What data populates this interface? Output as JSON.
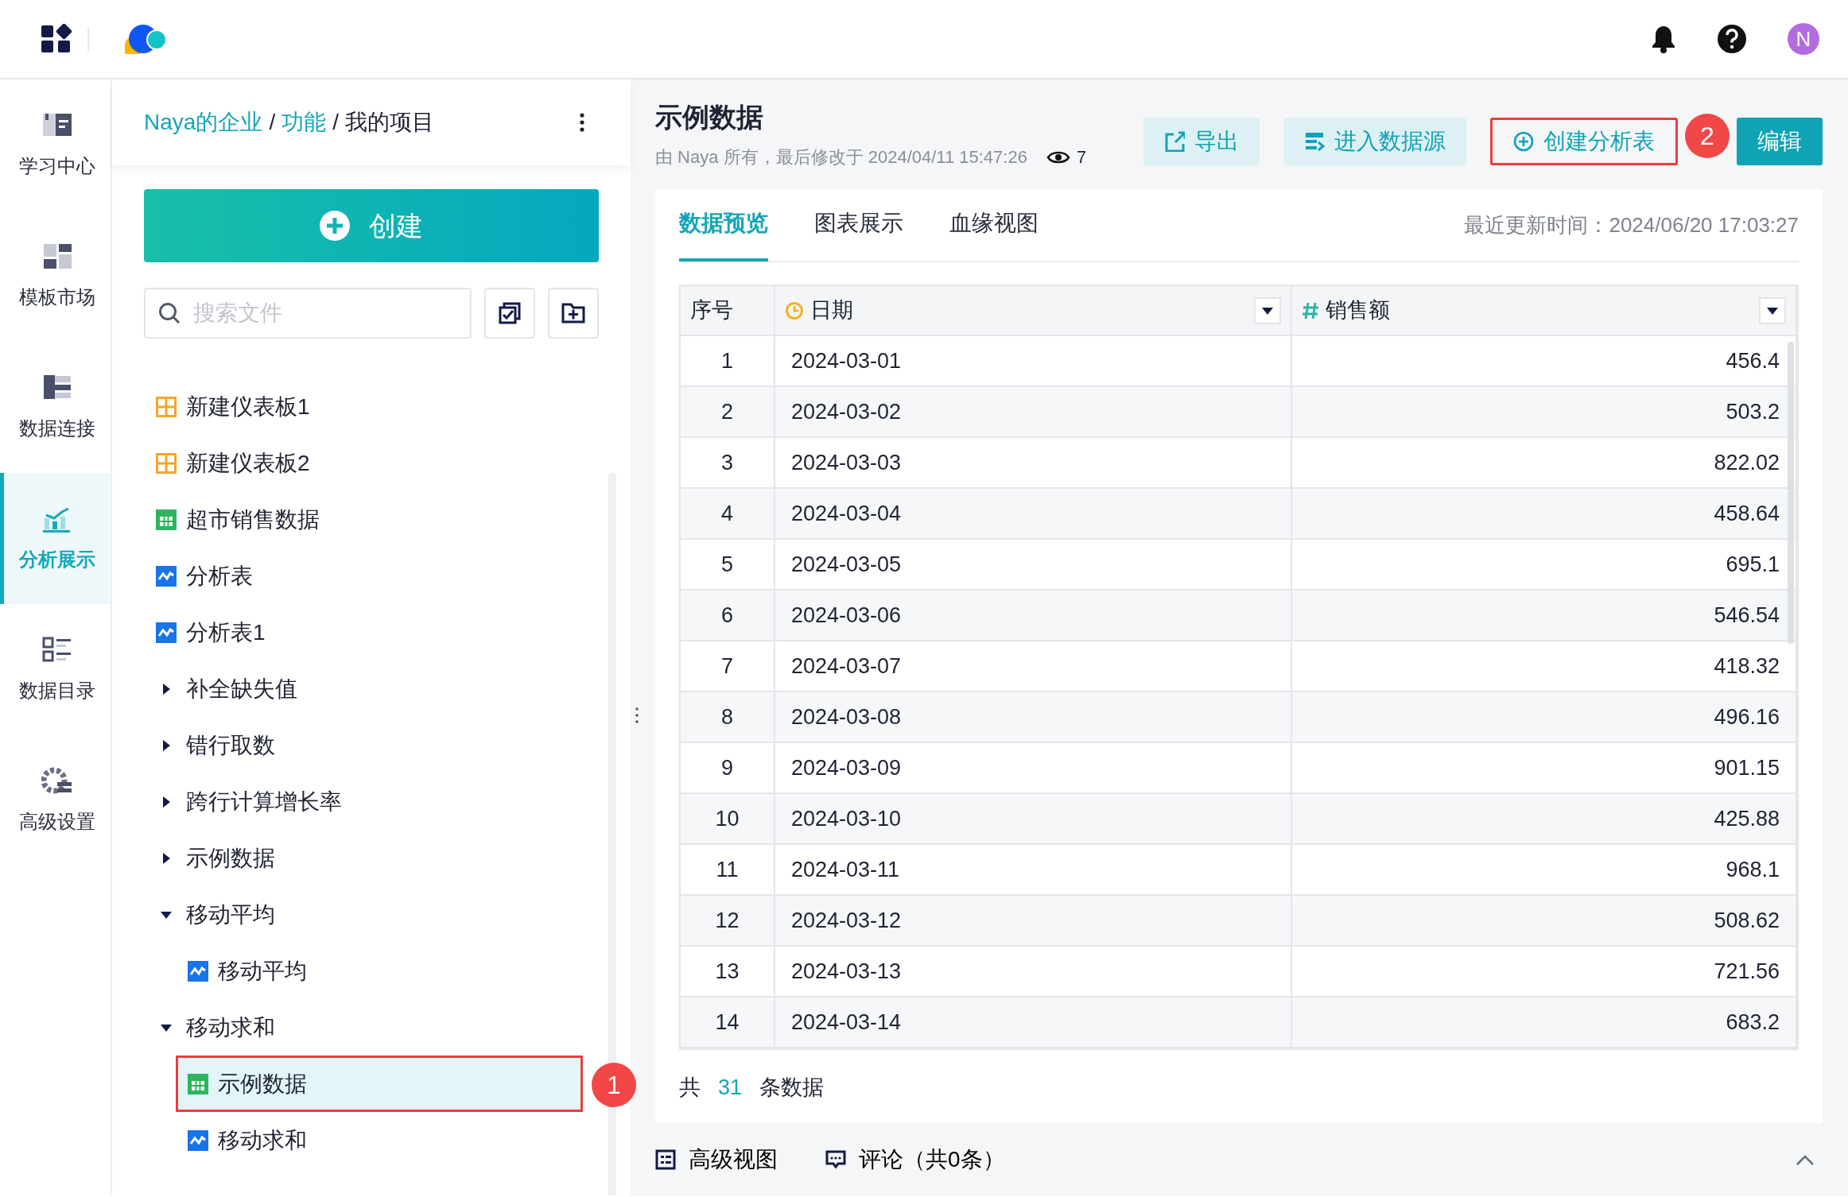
{
  "header": {
    "user": {
      "initial": "N"
    }
  },
  "nav": [
    {
      "label": "学习中心",
      "kind": "learn",
      "selected": false
    },
    {
      "label": "模板市场",
      "kind": "template",
      "selected": false
    },
    {
      "label": "数据连接",
      "kind": "connect",
      "selected": false
    },
    {
      "label": "分析展示",
      "kind": "analysis",
      "selected": true
    },
    {
      "label": "数据目录",
      "kind": "catalog",
      "selected": false
    },
    {
      "label": "高级设置",
      "kind": "settings",
      "selected": false
    }
  ],
  "files": {
    "breadcrumb": [
      {
        "label": "Naya的企业",
        "kind": "link"
      },
      {
        "label": "功能",
        "kind": "link"
      },
      {
        "label": "我的项目",
        "kind": "current"
      }
    ],
    "breadcrumb_separators": [
      "/",
      "/"
    ],
    "create_button": "创建",
    "search": {
      "placeholder": "搜索文件"
    },
    "tree": [
      {
        "label": "新建仪表板1",
        "kind": "dashboard",
        "selected": false
      },
      {
        "label": "新建仪表板2",
        "kind": "dashboard",
        "selected": false
      },
      {
        "label": "超市销售数据",
        "kind": "dataset",
        "selected": false
      },
      {
        "label": "分析表",
        "kind": "analysis",
        "selected": false
      },
      {
        "label": "分析表1",
        "kind": "analysis",
        "selected": false
      },
      {
        "label": "补全缺失值",
        "kind": "folder",
        "expanded": false,
        "selected": false
      },
      {
        "label": "错行取数",
        "kind": "folder",
        "expanded": false,
        "selected": false
      },
      {
        "label": "跨行计算增长率",
        "kind": "folder",
        "expanded": false,
        "selected": false
      },
      {
        "label": "示例数据",
        "kind": "folder",
        "expanded": false,
        "selected": false
      },
      {
        "label": "移动平均",
        "kind": "folder",
        "expanded": true,
        "selected": false,
        "children": [
          {
            "label": "移动平均",
            "kind": "analysis",
            "selected": false
          }
        ]
      },
      {
        "label": "移动求和",
        "kind": "folder",
        "expanded": true,
        "selected": false,
        "children": [
          {
            "label": "示例数据",
            "kind": "dataset",
            "selected": true,
            "callout": "1"
          },
          {
            "label": "移动求和",
            "kind": "analysis",
            "selected": false
          }
        ]
      }
    ]
  },
  "dataset": {
    "title": "示例数据",
    "meta": "由 Naya 所有，最后修改于 2024/04/11 15:47:26",
    "views": "7",
    "actions": [
      {
        "label": "导出",
        "kind": "export"
      },
      {
        "label": "进入数据源",
        "kind": "source"
      },
      {
        "label": "创建分析表",
        "kind": "create",
        "callout": "2"
      },
      {
        "label": "编辑",
        "kind": "edit"
      }
    ],
    "tabs": [
      {
        "label": "数据预览",
        "selected": true
      },
      {
        "label": "图表展示",
        "selected": false
      },
      {
        "label": "血缘视图",
        "selected": false
      }
    ],
    "updated": "最近更新时间：2024/06/20 17:03:27",
    "table": {
      "columns": [
        {
          "label": "序号",
          "kind": "index"
        },
        {
          "label": "日期",
          "kind": "date"
        },
        {
          "label": "销售额",
          "kind": "number"
        }
      ],
      "rows": [
        [
          "1",
          "2024-03-01",
          "456.4"
        ],
        [
          "2",
          "2024-03-02",
          "503.2"
        ],
        [
          "3",
          "2024-03-03",
          "822.02"
        ],
        [
          "4",
          "2024-03-04",
          "458.64"
        ],
        [
          "5",
          "2024-03-05",
          "695.1"
        ],
        [
          "6",
          "2024-03-06",
          "546.54"
        ],
        [
          "7",
          "2024-03-07",
          "418.32"
        ],
        [
          "8",
          "2024-03-08",
          "496.16"
        ],
        [
          "9",
          "2024-03-09",
          "901.15"
        ],
        [
          "10",
          "2024-03-10",
          "425.88"
        ],
        [
          "11",
          "2024-03-11",
          "968.1"
        ],
        [
          "12",
          "2024-03-12",
          "508.62"
        ],
        [
          "13",
          "2024-03-13",
          "721.56"
        ],
        [
          "14",
          "2024-03-14",
          "683.2"
        ]
      ]
    },
    "total": {
      "prefix": "共",
      "count": "31",
      "suffix": "条数据"
    }
  },
  "bottom_bar": [
    {
      "label": "高级视图",
      "kind": "advanced"
    },
    {
      "label": "评论（共0条）",
      "kind": "comment"
    }
  ]
}
